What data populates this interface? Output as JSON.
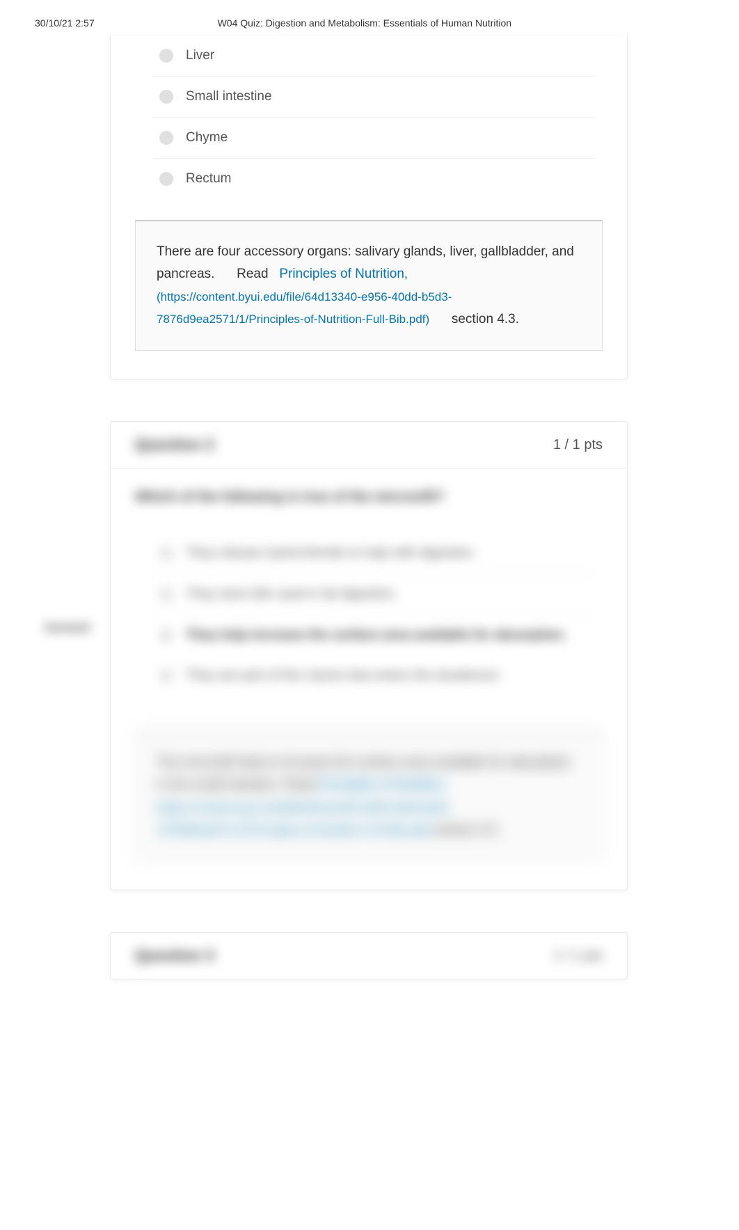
{
  "header": {
    "timestamp": "30/10/21 2:57",
    "title": "W04 Quiz: Digestion and Metabolism: Essentials of Human Nutrition"
  },
  "question1": {
    "options": [
      "Liver",
      "Small intestine",
      "Chyme",
      "Rectum"
    ],
    "feedback_intro": "There are four accessory organs: salivary glands, liver, gallbladder, and pancreas.",
    "feedback_read": "Read",
    "feedback_link_text": "Principles of Nutrition,",
    "feedback_url": "(https://content.byui.edu/file/64d13340-e956-40dd-b5d3-7876d9ea2571/1/Principles-of-Nutrition-Full-Bib.pdf)",
    "feedback_section": "section 4.3."
  },
  "question2": {
    "title": "Question 2",
    "points": "1 / 1 pts",
    "text": "Which of the following is true of the microvilli?",
    "correct_label": "Correct!",
    "options": [
      {
        "text": "They release hydrochloride to help with digestion.",
        "correct": false
      },
      {
        "text": "They store bile used in fat digestion.",
        "correct": false
      },
      {
        "text": "They help increase the surface area available for absorption.",
        "correct": true
      },
      {
        "text": "They are part of the chyme that enters the duodenum.",
        "correct": false
      }
    ],
    "feedback_intro": "The microvilli help to increase the surface area available for absorption in the small intestine.",
    "feedback_read": "Read",
    "feedback_link_text": "Principles of Nutrition,",
    "feedback_url": "(https://content.byui.edu/file/64d13340-e956-40dd-b5d3-7876d9ea2571/1/Principles-of-Nutrition-Full-Bib.pdf)",
    "feedback_section": "section 4.5."
  },
  "question3": {
    "title": "Question 3",
    "points": "1 / 1 pts"
  }
}
